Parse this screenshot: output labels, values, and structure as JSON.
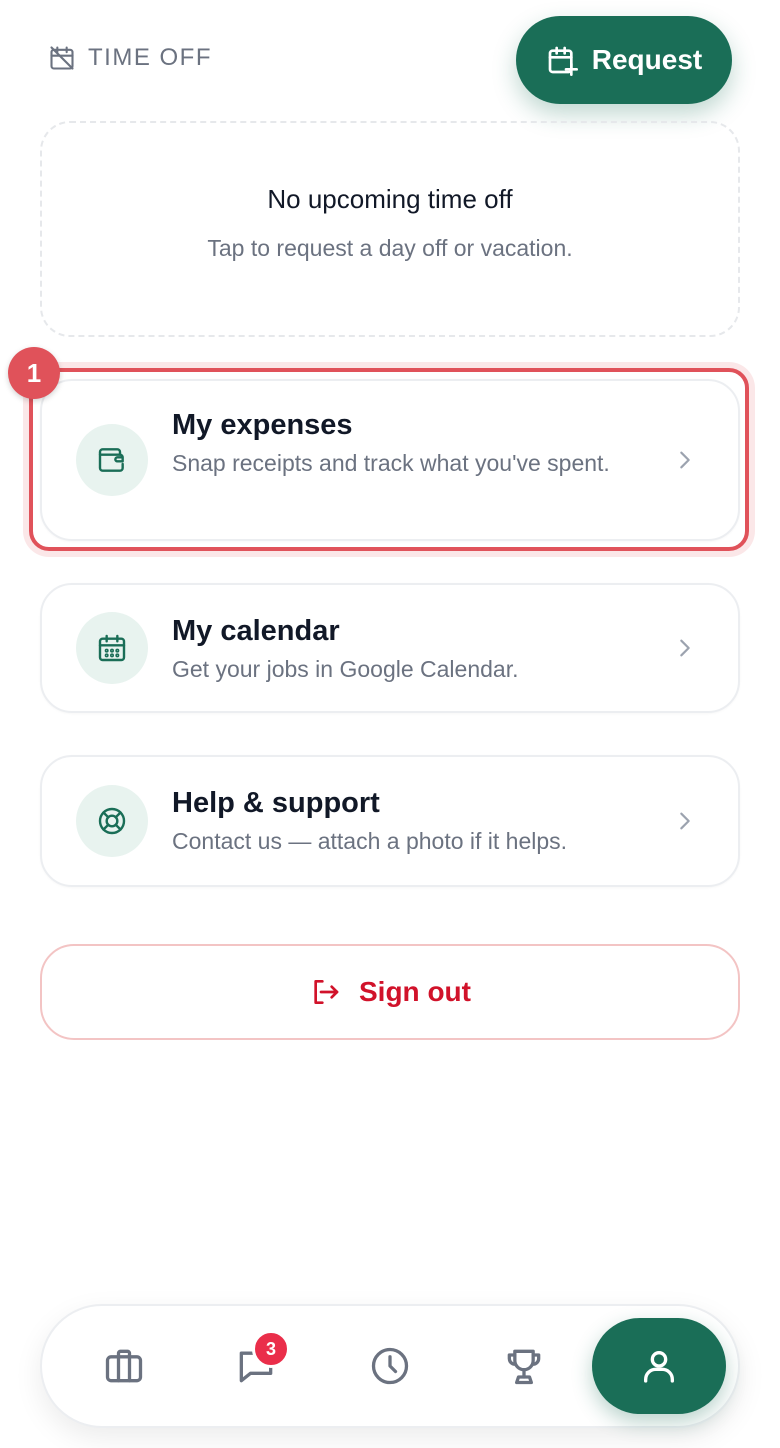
{
  "header": {
    "section_label": "TIME OFF",
    "request_label": "Request"
  },
  "empty_state": {
    "title": "No upcoming time off",
    "subtitle": "Tap to request a day off or vacation."
  },
  "menu": {
    "items": [
      {
        "title": "My expenses",
        "subtitle": "Snap receipts and track what you've spent."
      },
      {
        "title": "My calendar",
        "subtitle": "Get your jobs in Google Calendar."
      },
      {
        "title": "Help & support",
        "subtitle": "Contact us — attach a photo if it helps."
      }
    ]
  },
  "highlight": {
    "marker": "1"
  },
  "signout": {
    "label": "Sign out"
  },
  "tabbar": {
    "messages_badge": "3"
  },
  "icons": {
    "section": "calendar-off-icon",
    "request": "calendar-plus-icon",
    "expenses": "wallet-icon",
    "calendar": "calendar-grid-icon",
    "support": "lifebuoy-icon",
    "signout": "logout-icon",
    "tab_jobs": "briefcase-icon",
    "tab_messages": "chat-icon",
    "tab_history": "clock-icon",
    "tab_rewards": "trophy-icon",
    "tab_profile": "user-icon"
  },
  "colors": {
    "brand": "#1a6e57",
    "danger": "#d1122a",
    "highlight": "#e0525a",
    "badge": "#ea2e4a",
    "muted": "#6b7280"
  }
}
